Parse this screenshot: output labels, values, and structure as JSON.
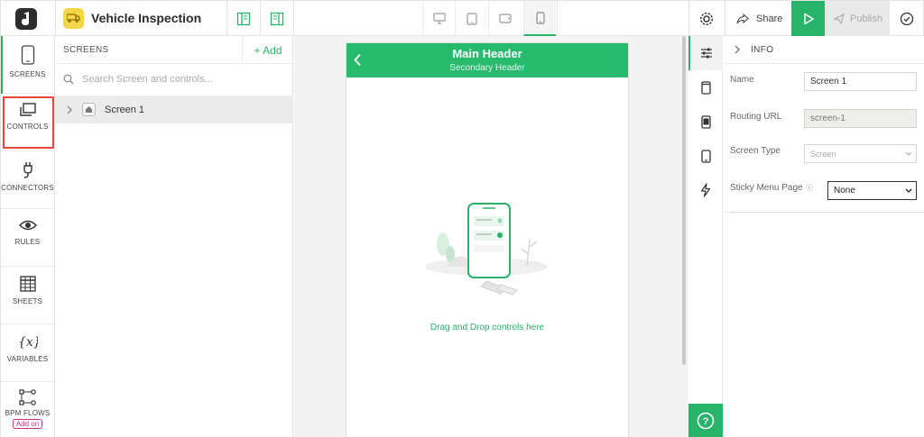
{
  "topbar": {
    "app_title": "Vehicle Inspection",
    "share_label": "Share",
    "publish_label": "Publish"
  },
  "leftnav": {
    "items": [
      {
        "label": "SCREENS",
        "icon": "phone-icon"
      },
      {
        "label": "CONTROLS",
        "icon": "controls-icon"
      },
      {
        "label": "CONNECTORS",
        "icon": "plug-icon"
      },
      {
        "label": "RULES",
        "icon": "eye-icon"
      },
      {
        "label": "SHEETS",
        "icon": "table-icon"
      },
      {
        "label": "VARIABLES",
        "icon": "variable-icon"
      },
      {
        "label": "BPM FLOWS",
        "icon": "flow-icon"
      }
    ],
    "addon_label": "Add on"
  },
  "screens_panel": {
    "title": "SCREENS",
    "add_label": "+ Add",
    "search_placeholder": "Search Screen and controls...",
    "screens": [
      {
        "name": "Screen 1"
      }
    ]
  },
  "canvas": {
    "main_header": "Main Header",
    "secondary_header": "Secondary Header",
    "drop_text": "Drag and Drop controls here"
  },
  "props": {
    "section": "INFO",
    "name_label": "Name",
    "name_value": "Screen 1",
    "routing_label": "Routing URL",
    "routing_value": "screen-1",
    "type_label": "Screen Type",
    "type_value": "Screen",
    "sticky_label": "Sticky Menu Page",
    "sticky_value": "None"
  },
  "colors": {
    "accent": "#27b36a",
    "highlight": "#e8453c",
    "addon": "#c03580"
  }
}
